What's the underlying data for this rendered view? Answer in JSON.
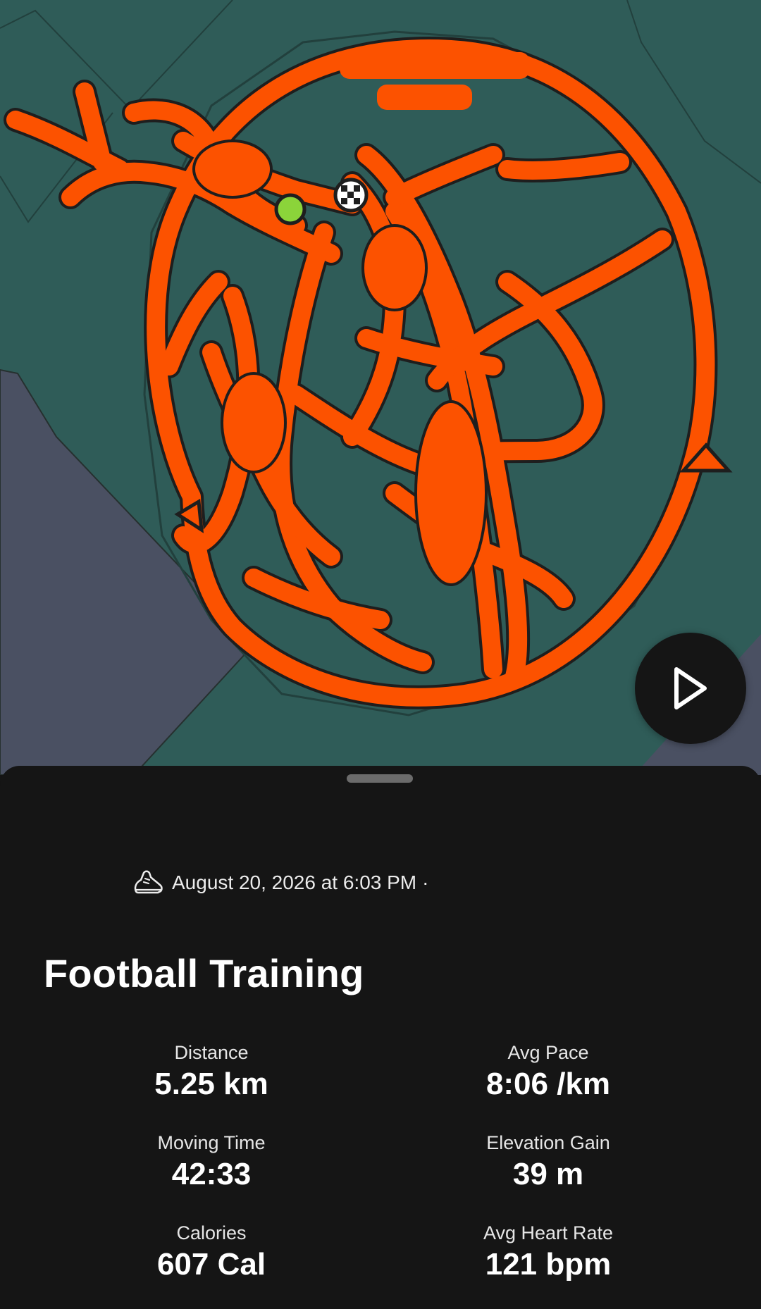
{
  "map": {
    "route_color": "#fc5200",
    "land_color": "#2f5c58",
    "building_color": "#4a5062",
    "start_marker_color": "#8bd43a",
    "finish_marker": "checkered-flag-icon"
  },
  "play_button": {
    "icon": "play-icon"
  },
  "activity": {
    "sport_icon": "running-shoe-icon",
    "datetime": "August 20, 2026 at 6:03 PM",
    "separator": "·",
    "title": "Football Training"
  },
  "stats": [
    {
      "label": "Distance",
      "value": "5.25 km"
    },
    {
      "label": "Avg Pace",
      "value": "8:06 /km"
    },
    {
      "label": "Moving Time",
      "value": "42:33"
    },
    {
      "label": "Elevation Gain",
      "value": "39 m"
    },
    {
      "label": "Calories",
      "value": "607 Cal"
    },
    {
      "label": "Avg Heart Rate",
      "value": "121 bpm"
    }
  ]
}
